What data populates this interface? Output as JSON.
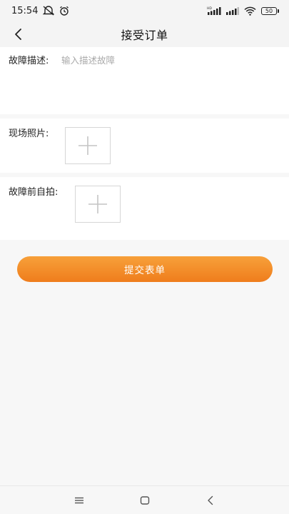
{
  "status_bar": {
    "time": "15:54",
    "battery": "50",
    "network_badge": "HD"
  },
  "header": {
    "title": "接受订单",
    "back_icon": "chevron-left-icon"
  },
  "form": {
    "description": {
      "label": "故障描述:",
      "value": "",
      "placeholder": "输入描述故障"
    },
    "site_photo": {
      "label": "现场照片:",
      "icon": "plus-icon"
    },
    "pre_fault_selfie": {
      "label": "故障前自拍:",
      "icon": "plus-icon"
    },
    "submit_label": "提交表单"
  },
  "system_nav": {
    "menu_icon": "menu-icon",
    "home_icon": "home-icon",
    "back_icon": "back-icon"
  },
  "colors": {
    "accent_top": "#f7a03a",
    "accent_bottom": "#ef7d1c",
    "background": "#f7f7f7",
    "card": "#ffffff"
  }
}
